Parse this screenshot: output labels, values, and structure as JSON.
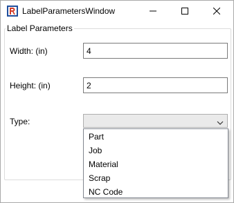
{
  "window": {
    "title": "LabelParametersWindow",
    "icons": {
      "app": "app-icon",
      "minimize": "minimize-icon",
      "maximize": "maximize-icon",
      "close": "close-icon"
    }
  },
  "group": {
    "legend": "Label Parameters"
  },
  "fields": {
    "width_label": "Width: (in)",
    "width_value": "4",
    "height_label": "Height: (in)",
    "height_value": "2",
    "type_label": "Type:",
    "type_selected": ""
  },
  "type_options": [
    "Part",
    "Job",
    "Material",
    "Scrap",
    "NC Code"
  ],
  "colors": {
    "combo_background": "#eaeaea",
    "textbox_border": "#7a7a7a",
    "dropdown_border": "#828790",
    "icon_blue": "#1f4e9c",
    "icon_red": "#d23c2a"
  }
}
